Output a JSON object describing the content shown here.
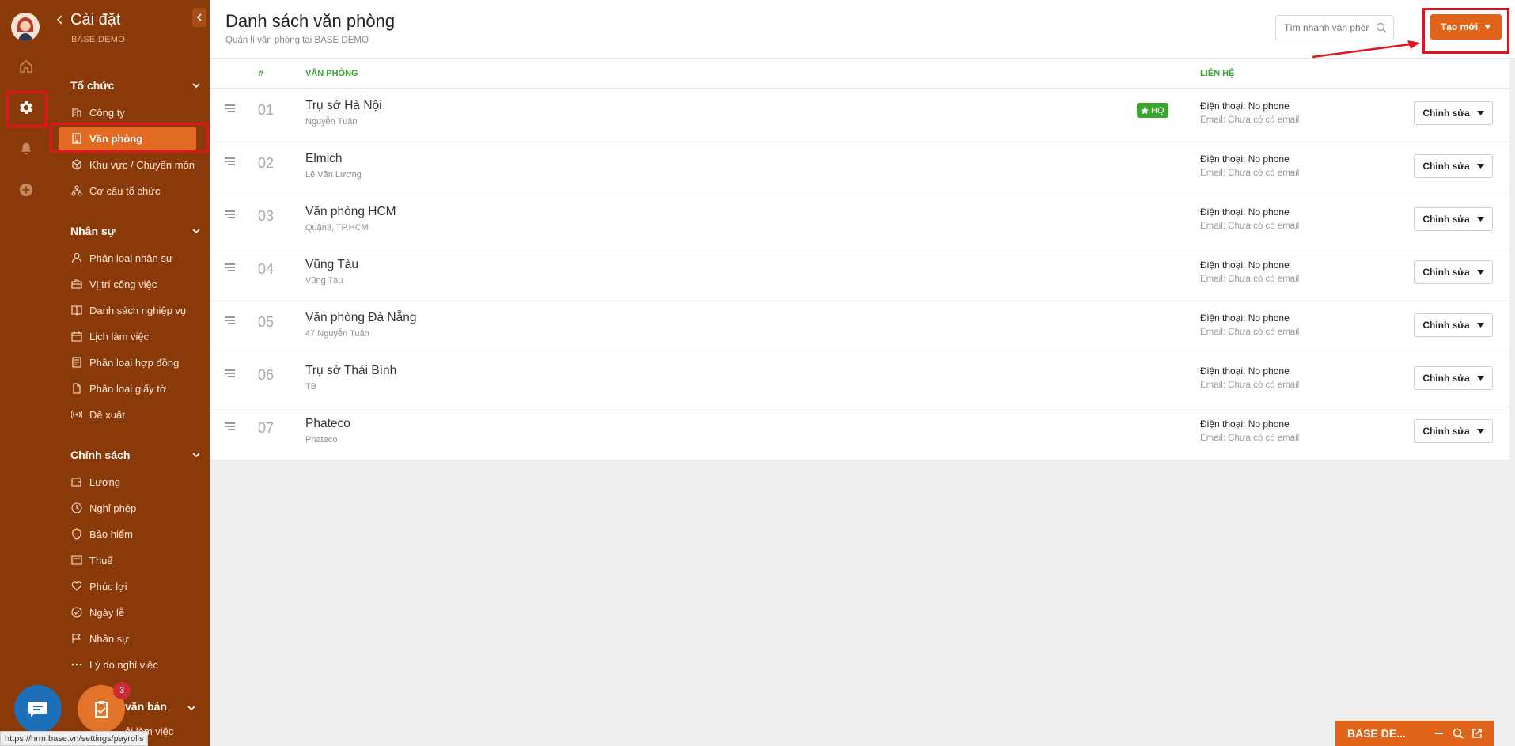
{
  "settings": {
    "title": "Cài đặt",
    "company": "BASE DEMO"
  },
  "sidebar": {
    "sections": [
      {
        "label": "Tổ chức",
        "items": [
          "Công ty",
          "Văn phòng",
          "Khu vực / Chuyên môn",
          "Cơ cấu tổ chức"
        ]
      },
      {
        "label": "Nhân sự",
        "items": [
          "Phân loại nhân sự",
          "Vị trí công việc",
          "Danh sách nghiệp vụ",
          "Lịch làm việc",
          "Phân loại hợp đồng",
          "Phân loại giấy tờ",
          "Đề xuất"
        ]
      },
      {
        "label": "Chính sách",
        "items": [
          "Lương",
          "Nghỉ phép",
          "Bảo hiểm",
          "Thuế",
          "Phúc lợi",
          "Ngày lễ",
          "Nhân sự",
          "Lý do nghỉ việc"
        ]
      }
    ],
    "partial_section": "văn bản",
    "partial_item": "ải làm việc",
    "active_item": "Văn phòng"
  },
  "header": {
    "title": "Danh sách văn phòng",
    "subtitle": "Quản lí văn phòng tại BASE DEMO",
    "search_placeholder": "Tìm nhanh văn phòng",
    "create_label": "Tạo mới"
  },
  "table": {
    "columns": [
      "#",
      "VĂN PHÒNG",
      "LIÊN HỆ"
    ],
    "rows": [
      {
        "num": "01",
        "name": "Trụ sở Hà Nội",
        "address": "Nguyễn Tuân",
        "hq": "HQ",
        "phone": "Điện thoại: No phone",
        "email": "Email: Chưa có có email"
      },
      {
        "num": "02",
        "name": "Elmich",
        "address": "Lê Văn Lương",
        "phone": "Điện thoại: No phone",
        "email": "Email: Chưa có có email"
      },
      {
        "num": "03",
        "name": "Văn phòng HCM",
        "address": "Quận3, TP.HCM",
        "phone": "Điện thoại: No phone",
        "email": "Email: Chưa có có email"
      },
      {
        "num": "04",
        "name": "Vũng Tàu",
        "address": "Vũng Tàu",
        "phone": "Điện thoại: No phone",
        "email": "Email: Chưa có có email"
      },
      {
        "num": "05",
        "name": "Văn phòng Đà Nẵng",
        "address": "47 Nguyễn Tuân",
        "phone": "Điện thoại: No phone",
        "email": "Email: Chưa có có email"
      },
      {
        "num": "06",
        "name": "Trụ sở Thái Bình",
        "address": "TB",
        "phone": "Điện thoại: No phone",
        "email": "Email: Chưa có có email"
      },
      {
        "num": "07",
        "name": "Phateco",
        "address": "Phateco",
        "phone": "Điện thoại: No phone",
        "email": "Email: Chưa có có email"
      }
    ],
    "edit_label": "Chỉnh sửa"
  },
  "bottom_bar": {
    "label": "BASE DE..."
  },
  "status_url": "https://hrm.base.vn/settings/payrolls",
  "task_badge": "3",
  "icons": {
    "home": "home-icon",
    "settings": "gear-icon",
    "notifications": "bell-icon",
    "add": "plus-circle-icon",
    "search": "search-icon",
    "drag": "drag-handle-icon",
    "caret": "caret-down-icon",
    "star": "star-icon",
    "chat": "chat-icon",
    "tasks": "clipboard-check-icon"
  },
  "colors": {
    "sidebar": "#8a3a09",
    "accent": "#e0651b",
    "active_item": "#e26a22",
    "header_green": "#38a632",
    "hq_badge": "#3aa62e",
    "highlight_red": "#e0141e"
  }
}
